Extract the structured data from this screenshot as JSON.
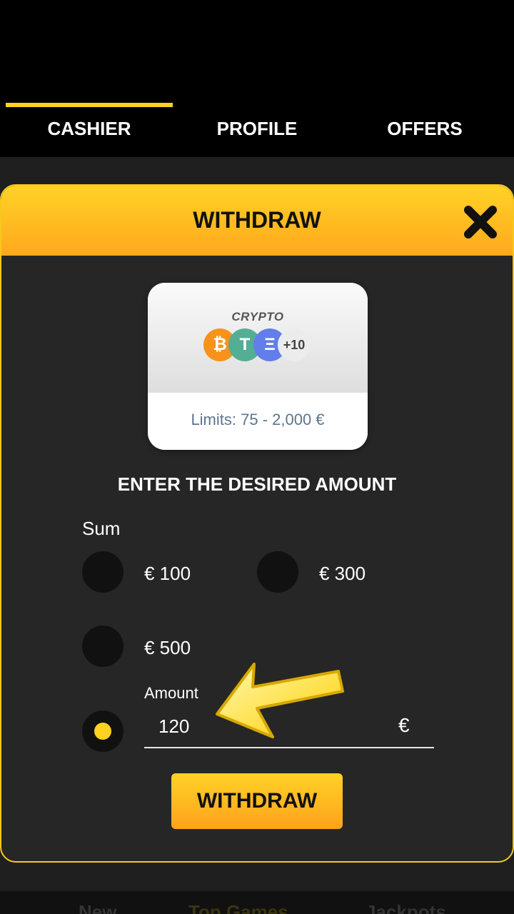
{
  "tabs": [
    "CASHIER",
    "PROFILE",
    "OFFERS"
  ],
  "modal": {
    "title": "WITHDRAW",
    "method": {
      "name": "CRYPTO",
      "coins": [
        "₿",
        "T",
        "Ξ"
      ],
      "more": "+10",
      "limits": "Limits: 75 - 2,000 €"
    },
    "section_title": "ENTER THE DESIRED AMOUNT",
    "sum_label": "Sum",
    "options": [
      "€ 100",
      "€ 300",
      "€ 500"
    ],
    "amount": {
      "label": "Amount",
      "value": "120",
      "currency": "€",
      "selected": true
    },
    "submit_label": "WITHDRAW"
  },
  "bottom_nav": [
    "New",
    "Top Games",
    "Jackpots"
  ],
  "colors": {
    "accent": "#ffd21f",
    "header_start": "#ffd226",
    "header_end": "#ffa81d",
    "panel": "#262626"
  },
  "icons": {
    "close": "close-icon",
    "arrow": "arrow-pointer-icon"
  }
}
